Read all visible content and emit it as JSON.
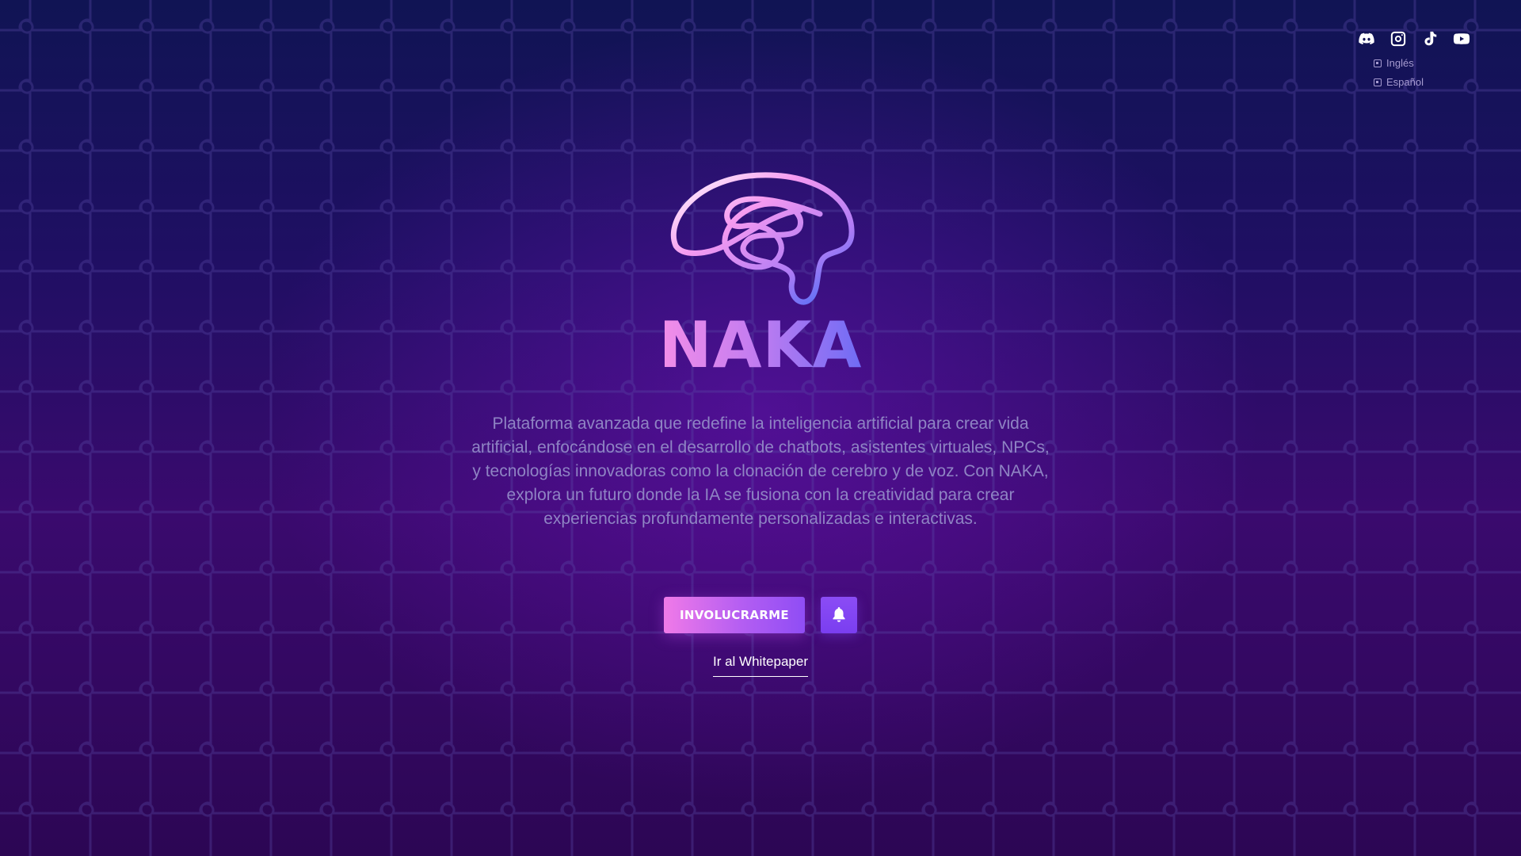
{
  "social": [
    {
      "name": "discord",
      "icon": "discord-icon"
    },
    {
      "name": "instagram",
      "icon": "instagram-icon"
    },
    {
      "name": "tiktok",
      "icon": "tiktok-icon"
    },
    {
      "name": "youtube",
      "icon": "youtube-icon"
    }
  ],
  "languages": {
    "english_label": "Inglés",
    "spanish_label": "Español"
  },
  "hero": {
    "logo_icon": "brain-icon",
    "brand": "NAKA",
    "description": "Plataforma avanzada que redefine la inteligencia artificial para crear vida artificial, enfocándose en el desarrollo de chatbots, asistentes virtuales, NPCs, y tecnologías innovadoras como la clonación de cerebro y de voz. Con NAKA, explora un futuro donde la IA se fusiona con la creatividad para crear experiencias profundamente personalizadas e interactivas.",
    "cta_label": "INVOLUCRARME",
    "bell_icon": "bell-icon",
    "whitepaper_label": "Ir al Whitepaper"
  },
  "colors": {
    "background_top": "#101454",
    "background_bottom": "#2c0654",
    "accent_pink": "#f07ae8",
    "accent_purple": "#8b4cf5",
    "description_text": "#8f84c4"
  }
}
